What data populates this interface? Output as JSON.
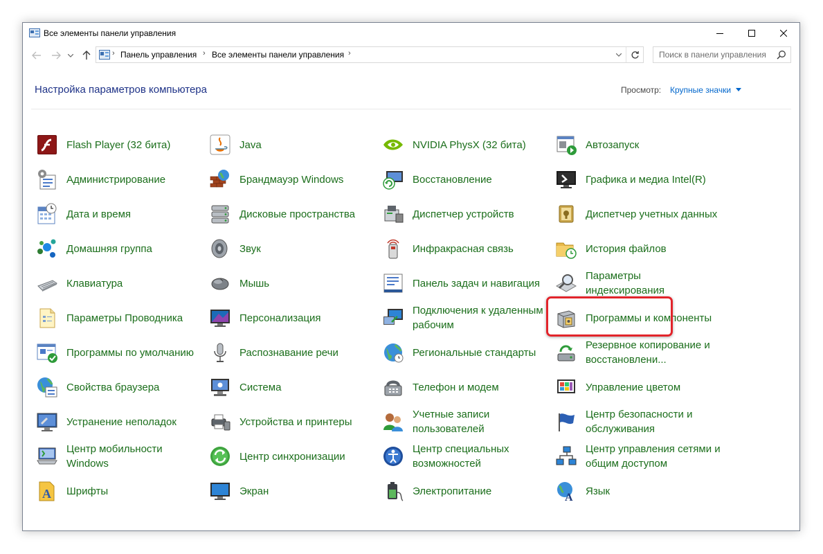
{
  "window": {
    "title": "Все элементы панели управления"
  },
  "addressbar": {
    "crumbs": [
      "Панель управления",
      "Все элементы панели управления"
    ]
  },
  "search": {
    "placeholder": "Поиск в панели управления"
  },
  "header": {
    "title": "Настройка параметров компьютера",
    "view_label": "Просмотр:",
    "view_value": "Крупные значки"
  },
  "colors": {
    "item_text": "#1b6e1b",
    "heading": "#1e3287",
    "link": "#0066cc",
    "highlight": "#e2242b"
  },
  "items": [
    {
      "label": "Flash Player (32 бита)",
      "icon": "flash-player-icon"
    },
    {
      "label": "Администрирование",
      "icon": "administration-icon"
    },
    {
      "label": "Дата и время",
      "icon": "date-time-icon"
    },
    {
      "label": "Домашняя группа",
      "icon": "homegroup-icon"
    },
    {
      "label": "Клавиатура",
      "icon": "keyboard-icon"
    },
    {
      "label": "Параметры Проводника",
      "icon": "explorer-options-icon"
    },
    {
      "label": "Программы по умолчанию",
      "icon": "default-programs-icon"
    },
    {
      "label": "Свойства браузера",
      "icon": "browser-properties-icon"
    },
    {
      "label": "Устранение неполадок",
      "icon": "troubleshooting-icon"
    },
    {
      "label": "Центр мобильности Windows",
      "icon": "mobility-center-icon"
    },
    {
      "label": "Шрифты",
      "icon": "fonts-icon"
    },
    {
      "label": "Java",
      "icon": "java-icon"
    },
    {
      "label": "Брандмауэр Windows",
      "icon": "firewall-icon"
    },
    {
      "label": "Дисковые пространства",
      "icon": "storage-spaces-icon"
    },
    {
      "label": "Звук",
      "icon": "sound-icon"
    },
    {
      "label": "Мышь",
      "icon": "mouse-icon"
    },
    {
      "label": "Персонализация",
      "icon": "personalization-icon"
    },
    {
      "label": "Распознавание речи",
      "icon": "speech-recognition-icon"
    },
    {
      "label": "Система",
      "icon": "system-icon"
    },
    {
      "label": "Устройства и принтеры",
      "icon": "devices-printers-icon"
    },
    {
      "label": "Центр синхронизации",
      "icon": "sync-center-icon"
    },
    {
      "label": "Экран",
      "icon": "display-icon"
    },
    {
      "label": "NVIDIA PhysX (32 бита)",
      "icon": "nvidia-icon"
    },
    {
      "label": "Восстановление",
      "icon": "recovery-icon"
    },
    {
      "label": "Диспетчер устройств",
      "icon": "device-manager-icon"
    },
    {
      "label": "Инфракрасная связь",
      "icon": "infrared-icon"
    },
    {
      "label": "Панель задач и навигация",
      "icon": "taskbar-icon"
    },
    {
      "label": "Подключения к удаленным рабочим",
      "icon": "remote-desktop-icon"
    },
    {
      "label": "Региональные стандарты",
      "icon": "region-icon"
    },
    {
      "label": "Телефон и модем",
      "icon": "phone-modem-icon"
    },
    {
      "label": "Учетные записи пользователей",
      "icon": "user-accounts-icon"
    },
    {
      "label": "Центр специальных возможностей",
      "icon": "ease-of-access-icon"
    },
    {
      "label": "Электропитание",
      "icon": "power-options-icon"
    },
    {
      "label": "Автозапуск",
      "icon": "autoplay-icon"
    },
    {
      "label": "Графика и медиа Intel(R)",
      "icon": "intel-graphics-icon"
    },
    {
      "label": "Диспетчер учетных данных",
      "icon": "credential-manager-icon"
    },
    {
      "label": "История файлов",
      "icon": "file-history-icon"
    },
    {
      "label": "Параметры индексирования",
      "icon": "indexing-options-icon"
    },
    {
      "label": "Программы и компоненты",
      "icon": "programs-features-icon"
    },
    {
      "label": "Резервное копирование и восстановлени...",
      "icon": "backup-restore-icon"
    },
    {
      "label": "Управление цветом",
      "icon": "color-management-icon"
    },
    {
      "label": "Центр безопасности и обслуживания",
      "icon": "security-maintenance-icon"
    },
    {
      "label": "Центр управления сетями и общим доступом",
      "icon": "network-sharing-icon"
    },
    {
      "label": "Язык",
      "icon": "language-icon"
    }
  ]
}
